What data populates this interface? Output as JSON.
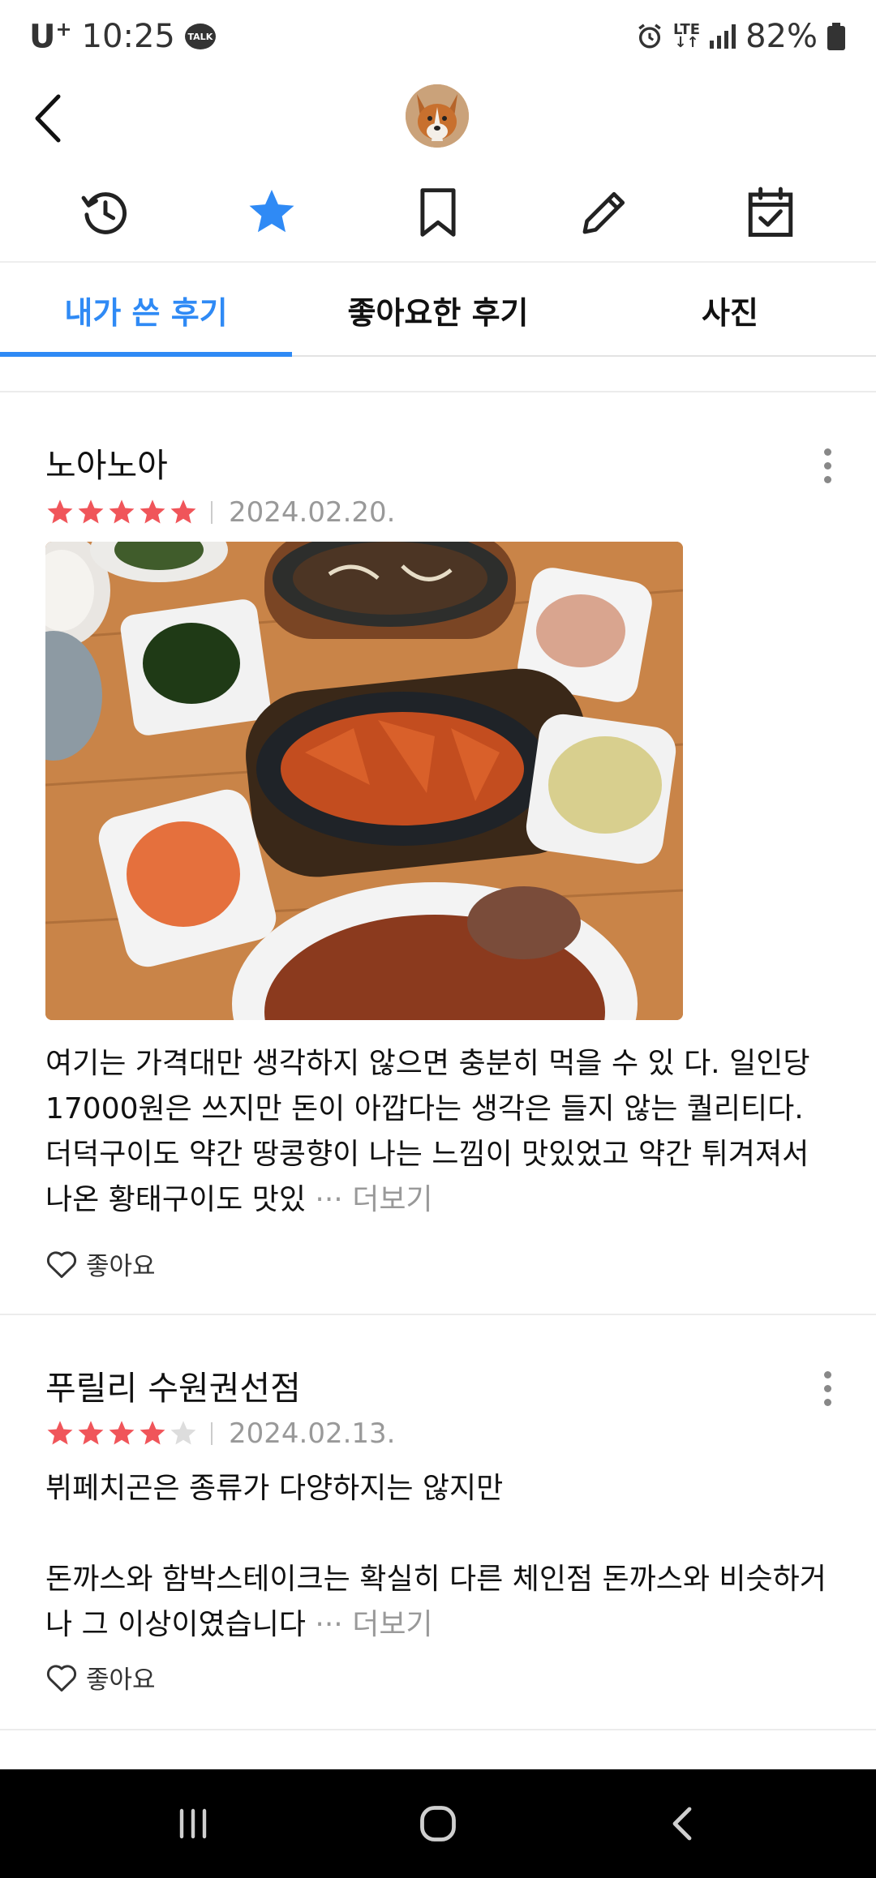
{
  "status_bar": {
    "carrier": "U",
    "carrier_sup": "+",
    "time": "10:25",
    "talk_badge": "TALK",
    "network": "LTE",
    "battery": "82%"
  },
  "tabs": [
    {
      "label": "내가 쓴 후기",
      "active": true
    },
    {
      "label": "좋아요한 후기",
      "active": false
    },
    {
      "label": "사진",
      "active": false
    }
  ],
  "reviews": [
    {
      "place": "노아노아",
      "rating": 5,
      "date": "2024.02.20.",
      "text": "여기는 가격대만 생각하지 않으면 충분히 먹을 수 있 다. 일인당 17000원은 쓰지만 돈이 아깝다는 생각은 들지 않는 퀄리티다. 더덕구이도 약간 땅콩향이 나는 느낌이 맛있었고 약간 튀겨져서 나온 황태구이도 맛있",
      "more": "··· 더보기",
      "like": "좋아요"
    },
    {
      "place": "푸릴리 수원권선점",
      "rating": 4,
      "date": "2024.02.13.",
      "text": "뷔페치곤은 종류가 다양하지는 않지만\n\n돈까스와 함박스테이크는 확실히 다른 체인점 돈까스와 비슷하거나 그 이상이였습니다",
      "more": "··· 더보기",
      "like": "좋아요"
    }
  ],
  "colors": {
    "accent": "#2f8af5",
    "star_on": "#f0555a",
    "star_off": "#dddddd"
  },
  "icons": [
    "back-arrow-icon",
    "history-icon",
    "star-icon",
    "bookmark-icon",
    "pencil-icon",
    "calendar-check-icon",
    "more-vertical-icon",
    "heart-icon",
    "recent-apps-icon",
    "home-icon",
    "back-icon"
  ]
}
